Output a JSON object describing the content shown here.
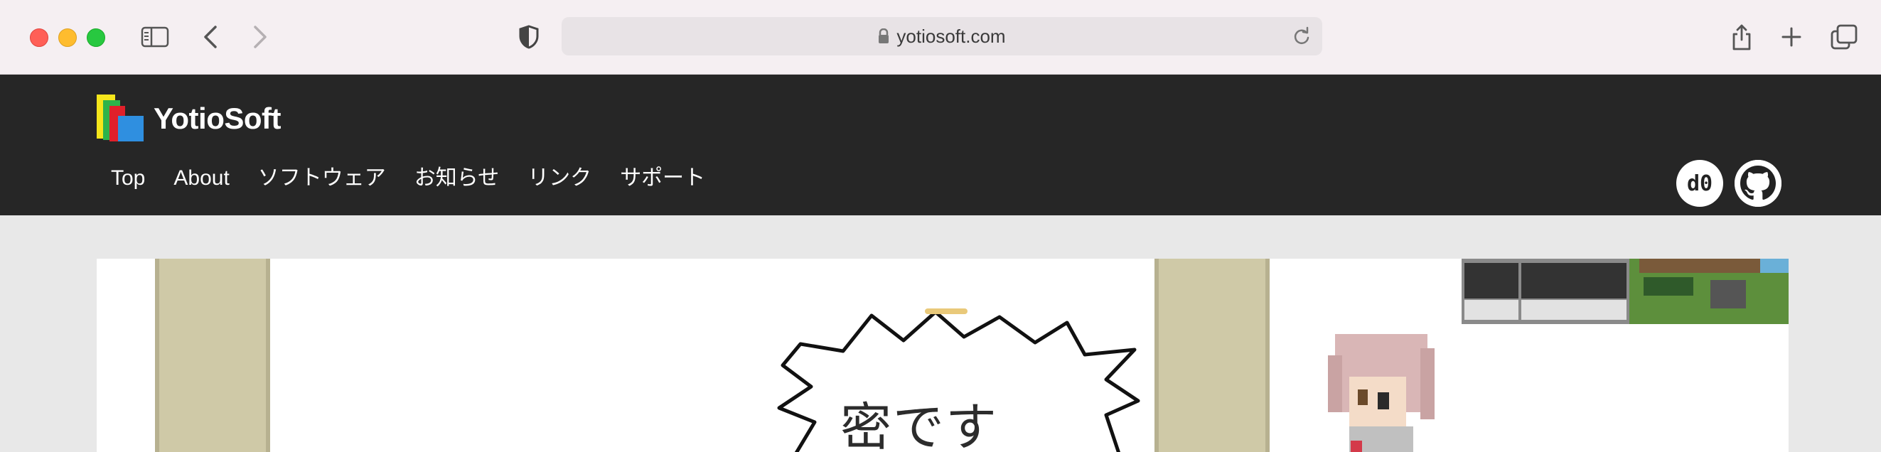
{
  "browser": {
    "url": "yotiosoft.com",
    "icons": {
      "sidebar": "sidebar-icon",
      "back": "chevron-left-icon",
      "forward": "chevron-right-icon",
      "privacy": "shield-icon",
      "lock": "lock-icon",
      "reload": "reload-icon",
      "share": "share-icon",
      "new_tab": "plus-icon",
      "tabs": "tab-overview-icon"
    }
  },
  "site": {
    "title": "YotioSoft",
    "nav": [
      {
        "label": "Top"
      },
      {
        "label": "About"
      },
      {
        "label": "ソフトウェア"
      },
      {
        "label": "お知らせ"
      },
      {
        "label": "リンク"
      },
      {
        "label": "サポート"
      }
    ],
    "social": {
      "d0_label": "d0",
      "github_icon": "github-icon"
    },
    "colors": {
      "header_bg": "#262626",
      "logo_yellow": "#f5e61b",
      "logo_green": "#2db34a",
      "logo_red": "#e0202a",
      "logo_blue": "#2f8fe0"
    }
  },
  "hero": {
    "bubble_text": "密です"
  }
}
